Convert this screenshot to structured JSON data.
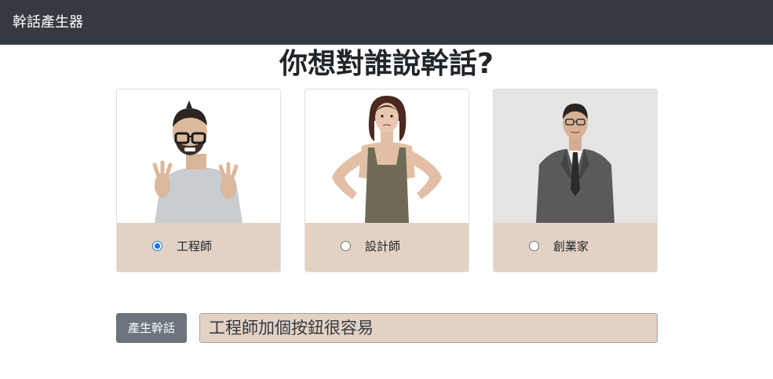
{
  "navbar": {
    "brand": "幹話產生器"
  },
  "main": {
    "heading": "你想對誰說幹話?"
  },
  "options": [
    {
      "label": "工程師",
      "checked": true
    },
    {
      "label": "設計師",
      "checked": false
    },
    {
      "label": "創業家",
      "checked": false
    }
  ],
  "actions": {
    "generate_label": "產生幹話",
    "output_value": "工程師加個按鈕很容易"
  },
  "colors": {
    "navbar": "#343a40",
    "card_body": "#e3d2c4",
    "button": "#6c757d",
    "radio_accent": "#1a73e8"
  }
}
